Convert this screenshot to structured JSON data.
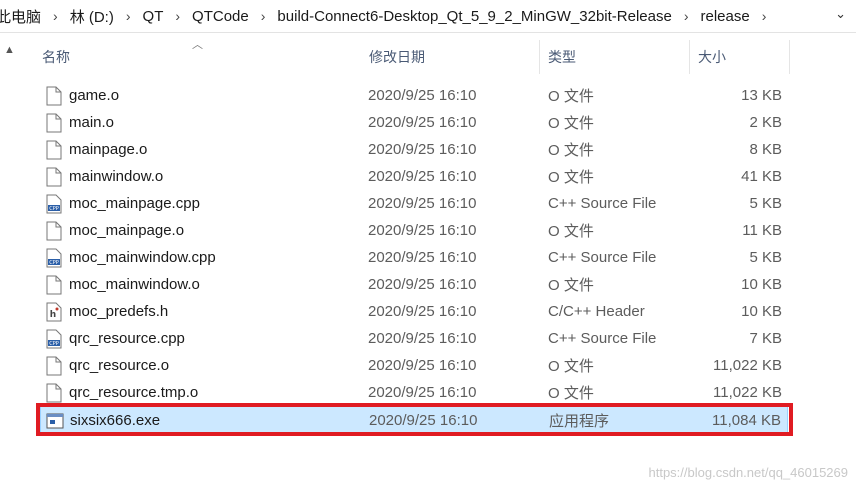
{
  "breadcrumb": {
    "items": [
      "此电脑",
      "林 (D:)",
      "QT",
      "QTCode",
      "build-Connect6-Desktop_Qt_5_9_2_MinGW_32bit-Release",
      "release"
    ],
    "separator": "›"
  },
  "columns": {
    "name": "名称",
    "date": "修改日期",
    "type": "类型",
    "size": "大小"
  },
  "files": [
    {
      "name": "game.o",
      "date": "2020/9/25 16:10",
      "type": "O 文件",
      "size": "13 KB",
      "icon": "blank-file-icon"
    },
    {
      "name": "main.o",
      "date": "2020/9/25 16:10",
      "type": "O 文件",
      "size": "2 KB",
      "icon": "blank-file-icon"
    },
    {
      "name": "mainpage.o",
      "date": "2020/9/25 16:10",
      "type": "O 文件",
      "size": "8 KB",
      "icon": "blank-file-icon"
    },
    {
      "name": "mainwindow.o",
      "date": "2020/9/25 16:10",
      "type": "O 文件",
      "size": "41 KB",
      "icon": "blank-file-icon"
    },
    {
      "name": "moc_mainpage.cpp",
      "date": "2020/9/25 16:10",
      "type": "C++ Source File",
      "size": "5 KB",
      "icon": "cpp-file-icon"
    },
    {
      "name": "moc_mainpage.o",
      "date": "2020/9/25 16:10",
      "type": "O 文件",
      "size": "11 KB",
      "icon": "blank-file-icon"
    },
    {
      "name": "moc_mainwindow.cpp",
      "date": "2020/9/25 16:10",
      "type": "C++ Source File",
      "size": "5 KB",
      "icon": "cpp-file-icon"
    },
    {
      "name": "moc_mainwindow.o",
      "date": "2020/9/25 16:10",
      "type": "O 文件",
      "size": "10 KB",
      "icon": "blank-file-icon"
    },
    {
      "name": "moc_predefs.h",
      "date": "2020/9/25 16:10",
      "type": "C/C++ Header",
      "size": "10 KB",
      "icon": "header-file-icon"
    },
    {
      "name": "qrc_resource.cpp",
      "date": "2020/9/25 16:10",
      "type": "C++ Source File",
      "size": "7 KB",
      "icon": "cpp-file-icon"
    },
    {
      "name": "qrc_resource.o",
      "date": "2020/9/25 16:10",
      "type": "O 文件",
      "size": "11,022 KB",
      "icon": "blank-file-icon"
    },
    {
      "name": "qrc_resource.tmp.o",
      "date": "2020/9/25 16:10",
      "type": "O 文件",
      "size": "11,022 KB",
      "icon": "blank-file-icon"
    },
    {
      "name": "sixsix666.exe",
      "date": "2020/9/25 16:10",
      "type": "应用程序",
      "size": "11,084 KB",
      "icon": "exe-file-icon",
      "selected": true
    }
  ],
  "watermark": "https://blog.csdn.net/qq_46015269",
  "colors": {
    "selection": "#cce8ff",
    "highlight_box": "#e01b22",
    "header_text": "#4a5a75"
  }
}
